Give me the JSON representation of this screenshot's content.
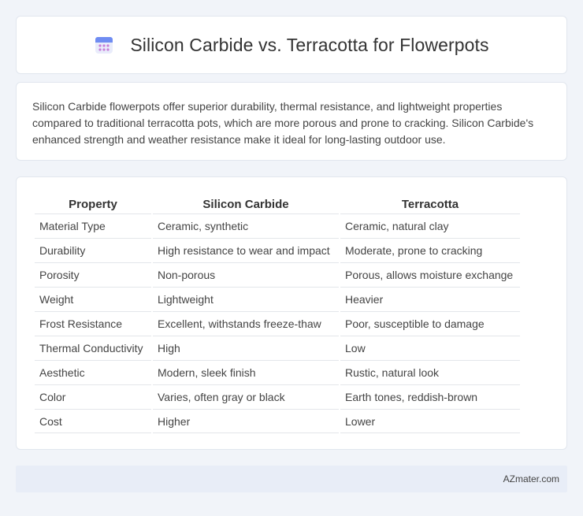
{
  "header": {
    "title": "Silicon Carbide vs. Terracotta for Flowerpots",
    "icon": "calendar-icon"
  },
  "intro": {
    "text": "Silicon Carbide flowerpots offer superior durability, thermal resistance, and lightweight properties compared to traditional terracotta pots, which are more porous and prone to cracking. Silicon Carbide's enhanced strength and weather resistance make it ideal for long-lasting outdoor use."
  },
  "table": {
    "headers": [
      "Property",
      "Silicon Carbide",
      "Terracotta"
    ],
    "rows": [
      [
        "Material Type",
        "Ceramic, synthetic",
        "Ceramic, natural clay"
      ],
      [
        "Durability",
        "High resistance to wear and impact",
        "Moderate, prone to cracking"
      ],
      [
        "Porosity",
        "Non-porous",
        "Porous, allows moisture exchange"
      ],
      [
        "Weight",
        "Lightweight",
        "Heavier"
      ],
      [
        "Frost Resistance",
        "Excellent, withstands freeze-thaw",
        "Poor, susceptible to damage"
      ],
      [
        "Thermal Conductivity",
        "High",
        "Low"
      ],
      [
        "Aesthetic",
        "Modern, sleek finish",
        "Rustic, natural look"
      ],
      [
        "Color",
        "Varies, often gray or black",
        "Earth tones, reddish-brown"
      ],
      [
        "Cost",
        "Higher",
        "Lower"
      ]
    ]
  },
  "footer": {
    "text": "AZmater.com"
  },
  "colors": {
    "background": "#f1f4f9",
    "card": "#ffffff",
    "footer": "#e8edf7",
    "icon_accent": "#7b8ff0"
  }
}
